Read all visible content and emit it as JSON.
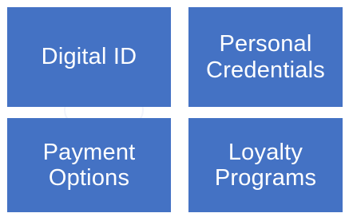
{
  "tiles": [
    {
      "lines": [
        "Digital ID"
      ]
    },
    {
      "lines": [
        "Personal",
        "Credentials"
      ]
    },
    {
      "lines": [
        "Payment",
        "Options"
      ]
    },
    {
      "lines": [
        "Loyalty",
        "Programs"
      ]
    }
  ],
  "colors": {
    "tile_fill": "#4472c4",
    "tile_text": "#ffffff",
    "background": "#ffffff"
  }
}
